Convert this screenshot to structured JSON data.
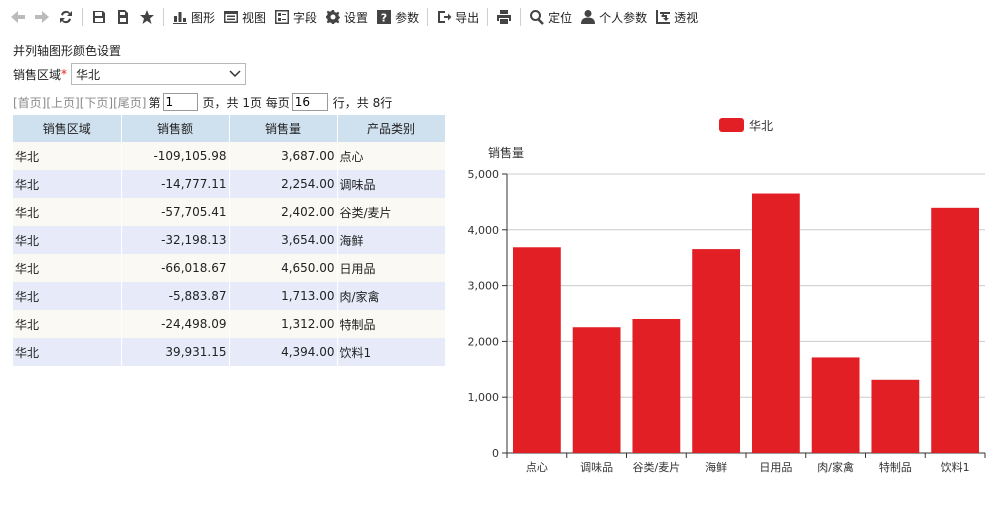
{
  "toolbar": {
    "items": [
      {
        "icon": "arrow-left-icon",
        "label": "",
        "disabled": true
      },
      {
        "icon": "arrow-right-icon",
        "label": "",
        "disabled": true
      },
      {
        "icon": "refresh-icon",
        "label": ""
      },
      {
        "icon": "save-icon",
        "label": ""
      },
      {
        "icon": "save-as-icon",
        "label": ""
      },
      {
        "icon": "star-icon",
        "label": ""
      },
      {
        "icon": "chart-icon",
        "label": "图形"
      },
      {
        "icon": "view-icon",
        "label": "视图"
      },
      {
        "icon": "fields-icon",
        "label": "字段"
      },
      {
        "icon": "gear-icon",
        "label": "设置"
      },
      {
        "icon": "question-icon",
        "label": "参数"
      },
      {
        "icon": "export-icon",
        "label": "导出"
      },
      {
        "icon": "print-icon",
        "label": ""
      },
      {
        "icon": "search-icon",
        "label": "定位"
      },
      {
        "icon": "user-icon",
        "label": "个人参数"
      },
      {
        "icon": "pivot-icon",
        "label": "透视"
      }
    ]
  },
  "params": {
    "title": "并列轴图形颜色设置",
    "region_label": "销售区域",
    "required_mark": "*",
    "region_value": "华北"
  },
  "pager": {
    "first": "[首页]",
    "prev": "[上页]",
    "next": "[下页]",
    "last": "[尾页]",
    "page_prefix": "第",
    "page_value": "1",
    "page_suffix": "页，共 1页 每页",
    "rows_value": "16",
    "rows_suffix": "行，共 8行"
  },
  "table": {
    "headers": [
      "销售区域",
      "销售额",
      "销售量",
      "产品类别"
    ],
    "rows": [
      [
        "华北",
        "-109,105.98",
        "3,687.00",
        "点心"
      ],
      [
        "华北",
        "-14,777.11",
        "2,254.00",
        "调味品"
      ],
      [
        "华北",
        "-57,705.41",
        "2,402.00",
        "谷类/麦片"
      ],
      [
        "华北",
        "-32,198.13",
        "3,654.00",
        "海鲜"
      ],
      [
        "华北",
        "-66,018.67",
        "4,650.00",
        "日用品"
      ],
      [
        "华北",
        "-5,883.87",
        "1,713.00",
        "肉/家禽"
      ],
      [
        "华北",
        "-24,498.09",
        "1,312.00",
        "特制品"
      ],
      [
        "华北",
        "39,931.15",
        "4,394.00",
        "饮料1"
      ]
    ]
  },
  "chart_data": {
    "type": "bar",
    "categories": [
      "点心",
      "调味品",
      "谷类/麦片",
      "海鲜",
      "日用品",
      "肉/家禽",
      "特制品",
      "饮料1"
    ],
    "series": [
      {
        "name": "华北",
        "values": [
          3687,
          2254,
          2402,
          3654,
          4650,
          1713,
          1312,
          4394
        ],
        "color": "#e31f26"
      }
    ],
    "ylabel": "销售量",
    "ylim": [
      0,
      5000
    ],
    "yticks": [
      0,
      1000,
      2000,
      3000,
      4000,
      5000
    ],
    "ytick_labels": [
      "0",
      "1,000",
      "2,000",
      "3,000",
      "4,000",
      "5,000"
    ],
    "grid": true,
    "legend_position": "top"
  }
}
